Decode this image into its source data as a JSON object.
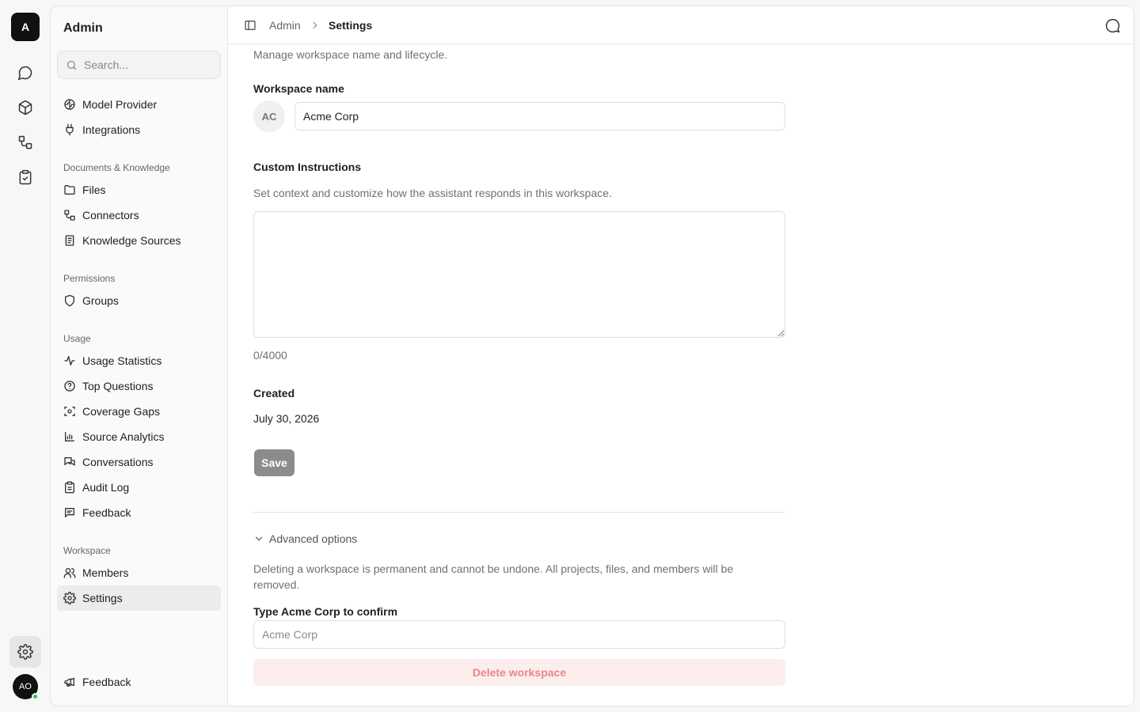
{
  "rail": {
    "logo": "A",
    "avatar": "AO",
    "items": [
      {
        "icon": "message-circle-icon"
      },
      {
        "icon": "cube-icon"
      },
      {
        "icon": "connectors-icon"
      },
      {
        "icon": "clipboard-check-icon"
      }
    ],
    "settings_icon": "gear-icon"
  },
  "sidebar": {
    "title": "Admin",
    "search_placeholder": "Search...",
    "items_top": [
      {
        "label": "Model Provider",
        "icon": "brain-icon"
      },
      {
        "label": "Integrations",
        "icon": "plug-icon"
      }
    ],
    "sections": [
      {
        "title": "Documents & Knowledge",
        "items": [
          {
            "label": "Files",
            "icon": "folder-icon"
          },
          {
            "label": "Connectors",
            "icon": "connectors-icon"
          },
          {
            "label": "Knowledge Sources",
            "icon": "document-icon"
          }
        ]
      },
      {
        "title": "Permissions",
        "items": [
          {
            "label": "Groups",
            "icon": "shield-icon"
          }
        ]
      },
      {
        "title": "Usage",
        "items": [
          {
            "label": "Usage Statistics",
            "icon": "activity-icon"
          },
          {
            "label": "Top Questions",
            "icon": "help-circle-icon"
          },
          {
            "label": "Coverage Gaps",
            "icon": "scan-icon"
          },
          {
            "label": "Source Analytics",
            "icon": "bar-chart-icon"
          },
          {
            "label": "Conversations",
            "icon": "messages-icon"
          },
          {
            "label": "Audit Log",
            "icon": "clipboard-icon"
          },
          {
            "label": "Feedback",
            "icon": "message-square-text-icon"
          }
        ]
      },
      {
        "title": "Workspace",
        "items": [
          {
            "label": "Members",
            "icon": "users-icon"
          },
          {
            "label": "Settings",
            "icon": "gear-icon",
            "active": true
          }
        ]
      }
    ],
    "footer_item": {
      "label": "Feedback",
      "icon": "megaphone-icon"
    }
  },
  "topbar": {
    "breadcrumb": [
      "Admin",
      "Settings"
    ],
    "toggle_icon": "sidebar-toggle-icon",
    "chat_icon": "chat-bubble-icon"
  },
  "main": {
    "subtitle": "Manage workspace name and lifecycle.",
    "workspace_name_label": "Workspace name",
    "workspace_initials": "AC",
    "workspace_name_value": "Acme Corp",
    "custom_instructions_label": "Custom Instructions",
    "custom_instructions_help": "Set context and customize how the assistant responds in this workspace.",
    "custom_instructions_value": "",
    "char_count": "0/4000",
    "created_label": "Created",
    "created_value": "July 30, 2026",
    "save_label": "Save",
    "advanced_label": "Advanced options",
    "delete_warning": "Deleting a workspace is permanent and cannot be undone. All projects, files, and members will be removed.",
    "confirm_prefix": "Type ",
    "confirm_name": "Acme Corp",
    "confirm_suffix": " to confirm",
    "confirm_placeholder": "Acme Corp",
    "delete_label": "Delete workspace"
  }
}
